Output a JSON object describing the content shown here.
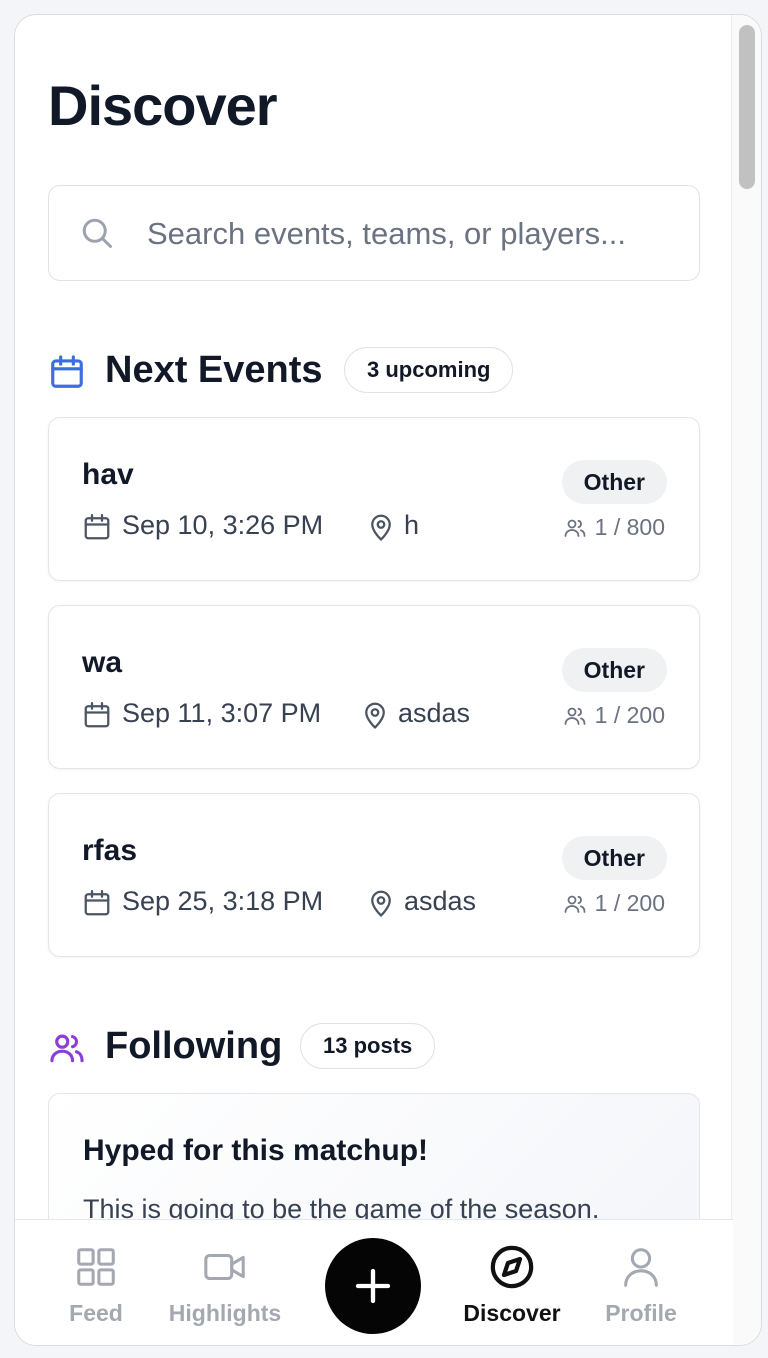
{
  "page": {
    "title": "Discover"
  },
  "search": {
    "placeholder": "Search events, teams, or players..."
  },
  "next_events": {
    "title": "Next Events",
    "badge": "3 upcoming",
    "items": [
      {
        "name": "hav",
        "date": "Sep 10, 3:26 PM",
        "location": "h",
        "category": "Other",
        "attendance": "1 / 800"
      },
      {
        "name": "wa",
        "date": "Sep 11, 3:07 PM",
        "location": "asdas",
        "category": "Other",
        "attendance": "1 / 200"
      },
      {
        "name": "rfas",
        "date": "Sep 25, 3:18 PM",
        "location": "asdas",
        "category": "Other",
        "attendance": "1 / 200"
      }
    ]
  },
  "following": {
    "title": "Following",
    "badge": "13 posts",
    "posts": [
      {
        "title": "Hyped for this matchup!",
        "body": "This is going to be the game of the season."
      }
    ]
  },
  "nav": {
    "items": [
      {
        "label": "Feed",
        "icon": "grid-icon",
        "active": false
      },
      {
        "label": "Highlights",
        "icon": "video-icon",
        "active": false
      },
      {
        "label": "",
        "icon": "plus-icon",
        "active": false
      },
      {
        "label": "Discover",
        "icon": "compass-icon",
        "active": true
      },
      {
        "label": "Profile",
        "icon": "user-icon",
        "active": false
      }
    ]
  },
  "colors": {
    "calendar_accent": "#3b6fe0",
    "following_accent": "#8b3fd6",
    "fab": "#050505"
  }
}
